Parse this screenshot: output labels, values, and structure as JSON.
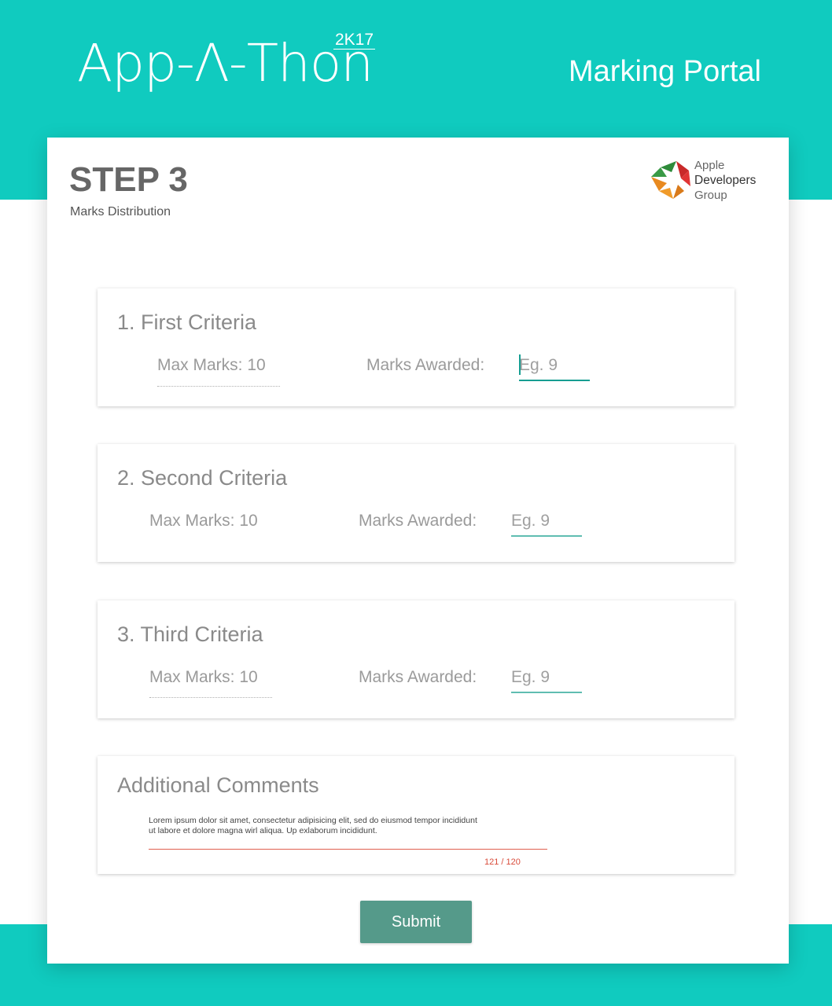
{
  "header": {
    "brand_name": "App-Λ-Thon",
    "brand_year": "2K17",
    "portal_title": "Marking Portal"
  },
  "step": {
    "title": "STEP 3",
    "subtitle": "Marks Distribution"
  },
  "org_logo": {
    "line1": "Apple",
    "line2": "Developers",
    "line3": "Group",
    "colors": [
      "#2e8b3a",
      "#d62b2b",
      "#e8841f"
    ]
  },
  "criteria": [
    {
      "title": "1. First Criteria",
      "max_marks": "Max Marks: 10",
      "awarded_label": "Marks Awarded:",
      "placeholder": "Eg. 9"
    },
    {
      "title": "2. Second Criteria",
      "max_marks": "Max Marks: 10",
      "awarded_label": "Marks Awarded:",
      "placeholder": "Eg. 9"
    },
    {
      "title": "3. Third Criteria",
      "max_marks": "Max Marks: 10",
      "awarded_label": "Marks Awarded:",
      "placeholder": "Eg. 9"
    }
  ],
  "comments": {
    "title": "Additional Comments",
    "text": "Lorem ipsum dolor sit amet, consectetur adipisicing elit, sed do eiusmod tempor incididunt ut labore et dolore magna wirl aliqua. Up exlaborum incididunt.",
    "counter": "121 / 120"
  },
  "submit_label": "Submit",
  "colors": {
    "accent_teal": "#10cbbf",
    "button": "#559a8a",
    "error": "#d94b3a"
  }
}
